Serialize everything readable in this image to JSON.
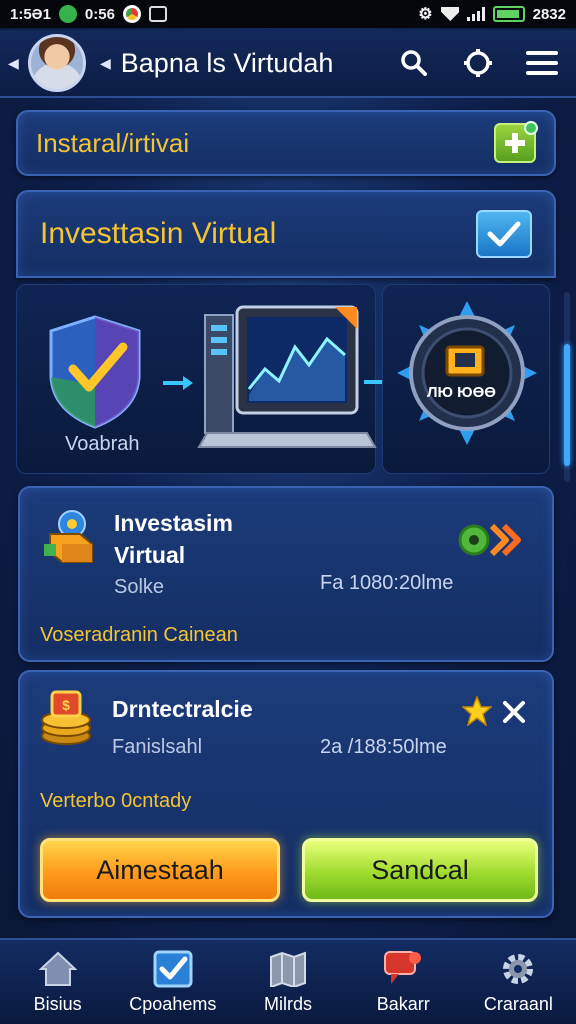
{
  "status_bar": {
    "time_left": "1:5Ә1",
    "time_mid": "0:56",
    "time_right": "2832"
  },
  "header": {
    "title": "Bapna ls Virtudah"
  },
  "install_panel": {
    "label": "Instaral/irtivai"
  },
  "virtual_panel": {
    "title": "Investtasin Virtual"
  },
  "illustration": {
    "shield_caption": "Voabrah",
    "dial_caption": "ЛЮ ЮӨӨ"
  },
  "card1": {
    "title_line1": "Investasim",
    "title_line2": "Virtual",
    "subtitle": "Solke",
    "time": "Fa 1080:20lme",
    "footer": "Voseradranin Cainean"
  },
  "card2": {
    "title": "Drntectralcie",
    "subtitle": "Fanislsahl",
    "time": "2a /188:50lme",
    "footer": "Verterbo 0cntady",
    "button_left": "Aimestaah",
    "button_right": "Sandcal"
  },
  "bottom_nav": [
    {
      "label": "Bisius"
    },
    {
      "label": "Cpoahems"
    },
    {
      "label": "Milrds"
    },
    {
      "label": "Bakarr"
    },
    {
      "label": "Craraanl"
    }
  ],
  "colors": {
    "accent_gold": "#f5c431",
    "accent_blue": "#3fa7ff",
    "button_orange": "#ff9a1a",
    "button_green": "#9fdc2e"
  }
}
